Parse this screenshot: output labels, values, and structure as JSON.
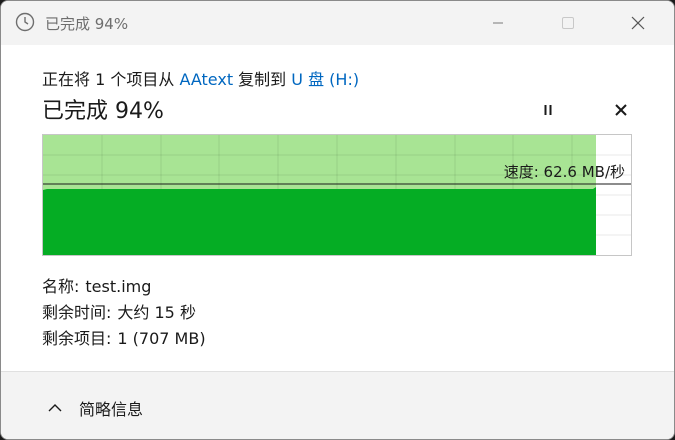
{
  "window": {
    "title": "已完成 94%"
  },
  "copy": {
    "prefix": "正在将 1 个项目从 ",
    "source": "AAtext",
    "middle": " 复制到 ",
    "destination": "U 盘 (H:)"
  },
  "progress": {
    "heading": "已完成 94%",
    "percent": 94,
    "speed_text": "速度: 62.6 MB/秒"
  },
  "details": {
    "name_label": "名称:",
    "name_value": "test.img",
    "time_label": "剩余时间:",
    "time_value": "大约 15 秒",
    "items_label": "剩余项目:",
    "items_value": "1 (707 MB)"
  },
  "footer": {
    "toggle_label": "简略信息"
  },
  "colors": {
    "progress_fill_light": "#a8e494",
    "speed_area": "#05ad24",
    "link": "#0067c0"
  },
  "icons": {
    "title": "clock-icon",
    "pause": "pause-icon",
    "cancel": "close-icon",
    "toggle": "chevron-up-icon"
  }
}
